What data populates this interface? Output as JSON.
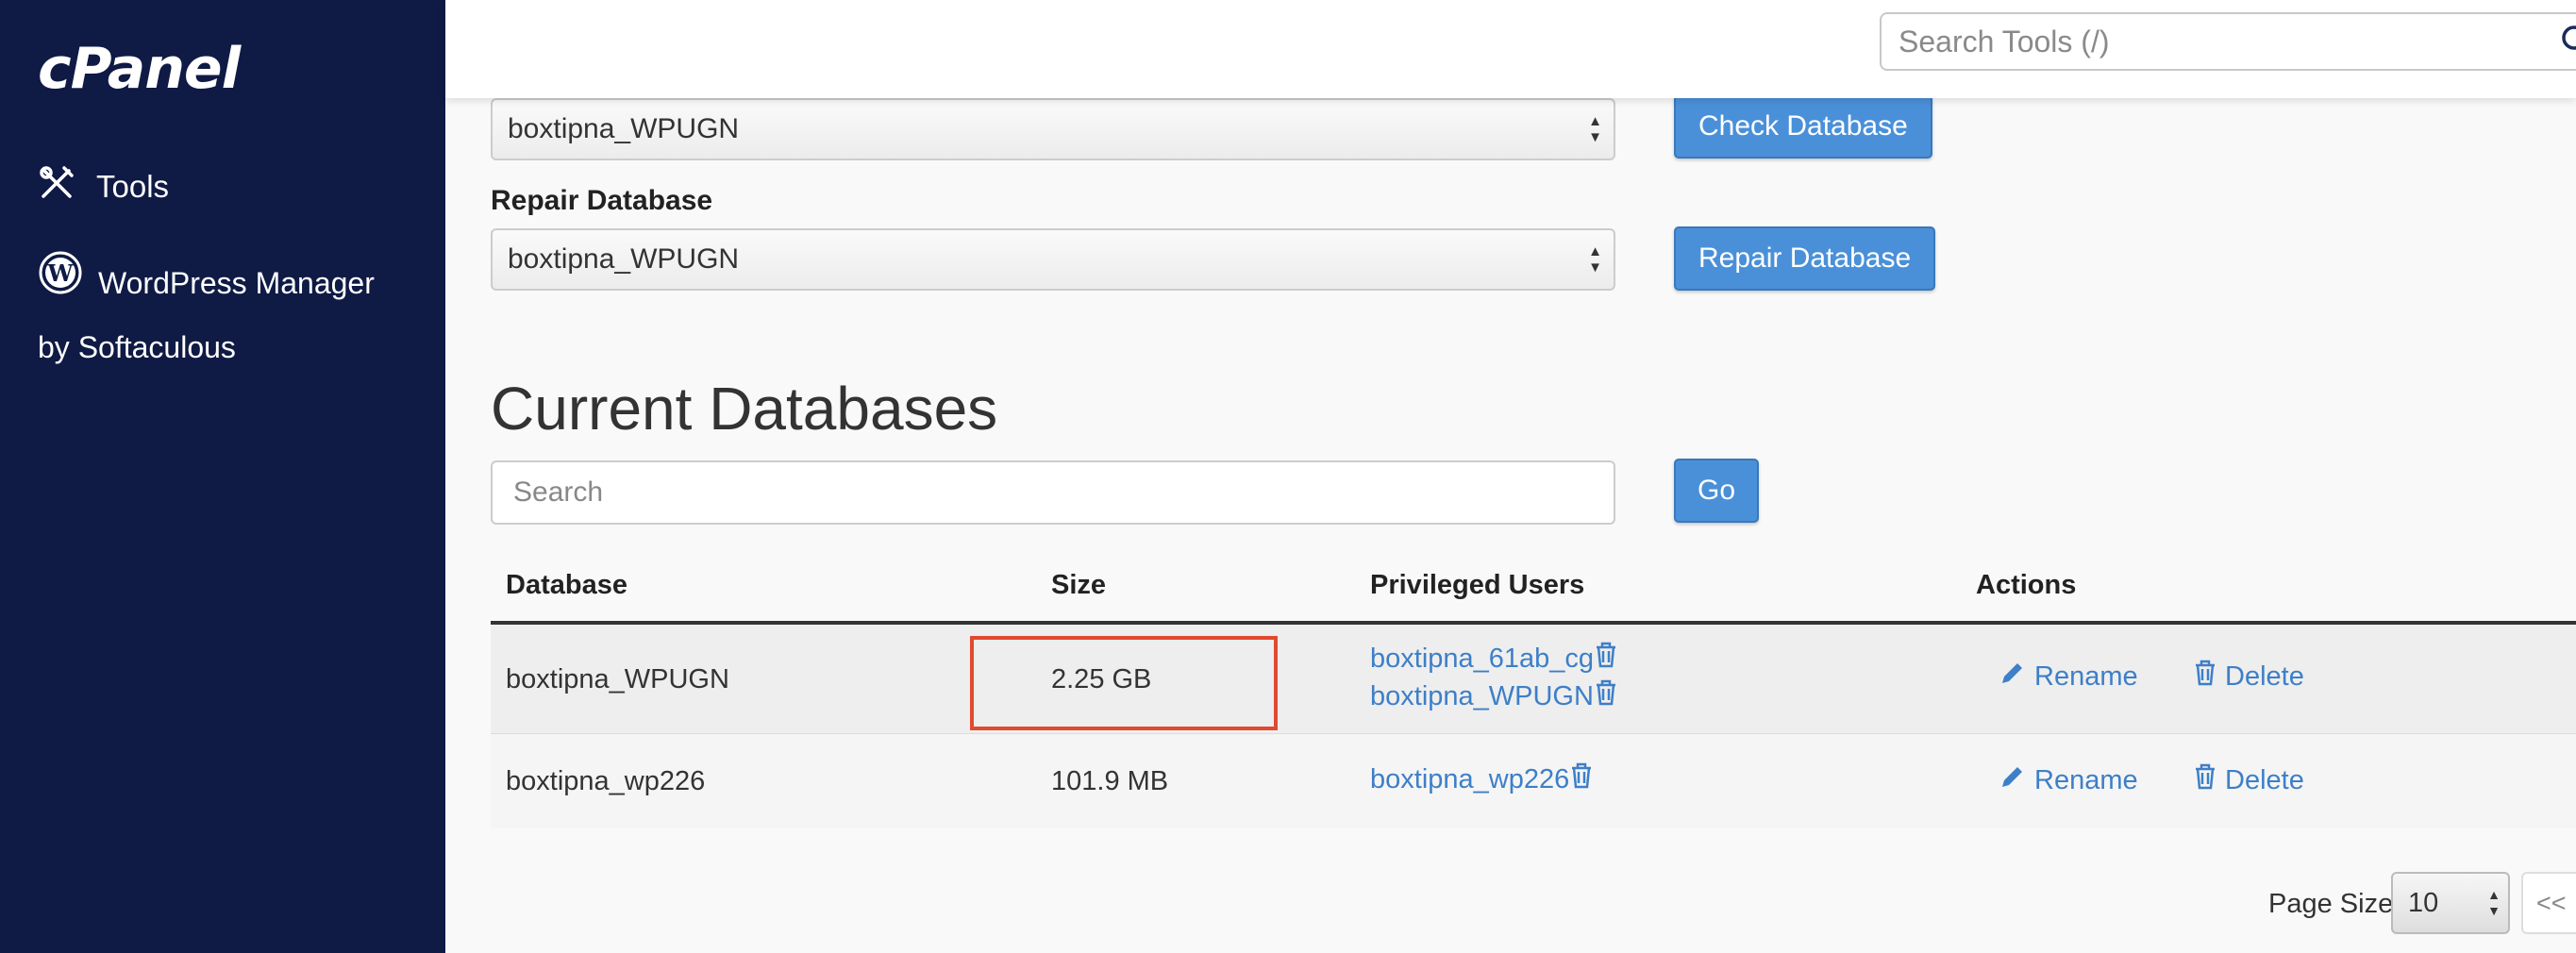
{
  "sidebar": {
    "logo": "cPanel",
    "items": [
      {
        "label": "Tools",
        "icon": "tools-icon"
      },
      {
        "label": "WordPress Manager",
        "label2": "by Softaculous",
        "icon": "wordpress-icon"
      }
    ]
  },
  "header": {
    "search_placeholder": "Search Tools (/)"
  },
  "check": {
    "selected": "boxtipna_WPUGN",
    "button": "Check Database"
  },
  "repair": {
    "label": "Repair Database",
    "selected": "boxtipna_WPUGN",
    "button": "Repair Database"
  },
  "current": {
    "title": "Current Databases",
    "search_placeholder": "Search",
    "go": "Go",
    "columns": [
      "Database",
      "Size",
      "Privileged Users",
      "Actions"
    ],
    "rows": [
      {
        "database": "boxtipna_WPUGN",
        "size": "2.25 GB",
        "users": [
          "boxtipna_61ab_cg",
          "boxtipna_WPUGN"
        ],
        "rename": "Rename",
        "delete": "Delete"
      },
      {
        "database": "boxtipna_wp226",
        "size": "101.9 MB",
        "users": [
          "boxtipna_wp226"
        ],
        "rename": "Rename",
        "delete": "Delete"
      }
    ]
  },
  "pagination": {
    "page_size_label": "Page Size",
    "page_size": "10",
    "first": "<<"
  },
  "colors": {
    "sidebar": "#0f1a45",
    "primary_button": "#4a90d9",
    "link": "#3d7fc8",
    "highlight": "#e04a2f"
  }
}
